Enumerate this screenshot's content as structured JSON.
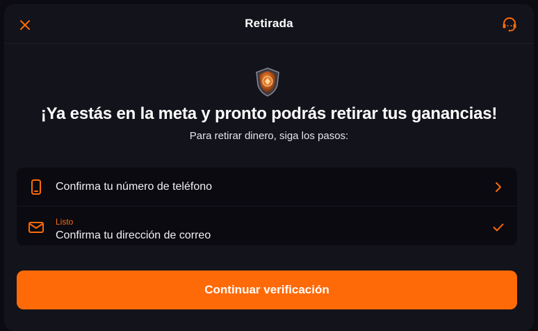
{
  "header": {
    "title": "Retirada",
    "close_icon": "close-icon",
    "support_icon": "headset-support-icon"
  },
  "hero": {
    "badge_icon": "shield-badge-icon",
    "headline": "¡Ya estás en la meta y pronto podrás retirar tus ganancias!",
    "subline": "Para retirar dinero, siga los pasos:"
  },
  "steps": [
    {
      "icon": "phone-icon",
      "label": "Confirma tu número de teléfono",
      "status": "",
      "end_icon": "chevron-right-icon"
    },
    {
      "icon": "mail-icon",
      "label": "Confirma tu dirección de correo",
      "status": "Listo",
      "end_icon": "checkmark-icon"
    }
  ],
  "cta": {
    "label": "Continuar verificación"
  },
  "colors": {
    "accent": "#ff6a08",
    "background": "#13131b",
    "card": "#0a0a10"
  }
}
